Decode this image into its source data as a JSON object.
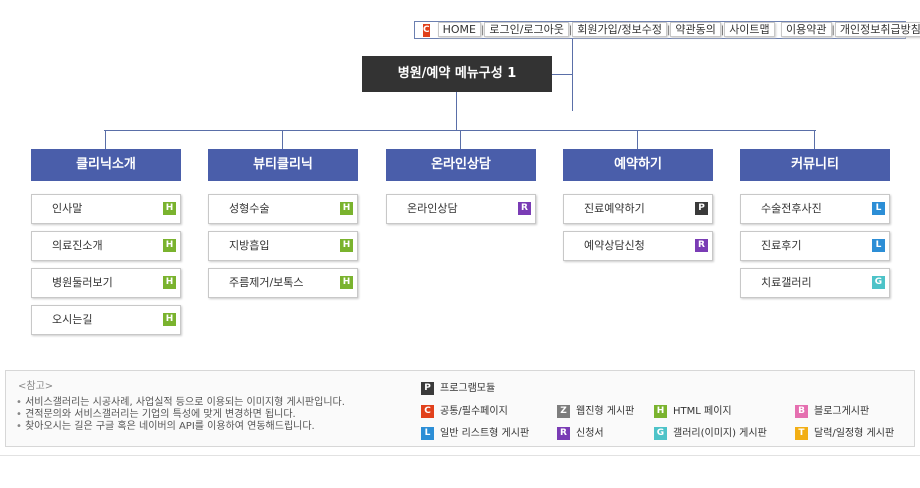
{
  "top_nav": {
    "badge": "C",
    "links": [
      "HOME",
      "로그인/로그아웃",
      "회원가입/정보수정",
      "약관동의",
      "사이트맵",
      "이용약관",
      "개인정보취급방침"
    ]
  },
  "title": "병원/예약 메뉴구성 1",
  "categories": [
    {
      "label": "클리닉소개",
      "items": [
        {
          "label": "인사말",
          "badge": "H"
        },
        {
          "label": "의료진소개",
          "badge": "H"
        },
        {
          "label": "병원둘러보기",
          "badge": "H"
        },
        {
          "label": "오시는길",
          "badge": "H"
        }
      ]
    },
    {
      "label": "뷰티클리닉",
      "items": [
        {
          "label": "성형수술",
          "badge": "H"
        },
        {
          "label": "지방흡입",
          "badge": "H"
        },
        {
          "label": "주름제거/보톡스",
          "badge": "H"
        }
      ]
    },
    {
      "label": "온라인상담",
      "items": [
        {
          "label": "온라인상담",
          "badge": "R"
        }
      ]
    },
    {
      "label": "예약하기",
      "items": [
        {
          "label": "진료예약하기",
          "badge": "P"
        },
        {
          "label": "예약상담신청",
          "badge": "R"
        }
      ]
    },
    {
      "label": "커뮤니티",
      "items": [
        {
          "label": "수술전후사진",
          "badge": "L"
        },
        {
          "label": "진료후기",
          "badge": "L"
        },
        {
          "label": "치료갤러리",
          "badge": "G"
        }
      ]
    }
  ],
  "note": {
    "heading": "<참고>",
    "lines": [
      "서비스갤러리는 시공사례, 사업실적 등으로 이용되는 이미지형 게시판입니다.",
      "견적문의와 서비스갤러리는 기업의 특성에 맞게 변경하면 됩니다.",
      "찾아오시는 길은 구글 혹은 네이버의 API를 이용하여 연동해드립니다."
    ]
  },
  "legend": [
    {
      "badge": "P",
      "label": "프로그램모듈"
    },
    {
      "badge": "C",
      "label": "공통/필수페이지"
    },
    {
      "badge": "Z",
      "label": "웹진형 게시판"
    },
    {
      "badge": "H",
      "label": "HTML 페이지"
    },
    {
      "badge": "B",
      "label": "블로그게시판"
    },
    {
      "badge": "L",
      "label": "일반 리스트형 게시판"
    },
    {
      "badge": "R",
      "label": "신청서"
    },
    {
      "badge": "G",
      "label": "갤러리(이미지) 게시판"
    },
    {
      "badge": "T",
      "label": "달력/일정형 게시판"
    }
  ],
  "badge_colors": {
    "P": "#3a3a3a",
    "C": "#e1401b",
    "Z": "#7d7d7d",
    "H": "#7ab32e",
    "B": "#e56fb0",
    "L": "#2c8ed6",
    "R": "#7a3cb5",
    "G": "#4dc3c8",
    "T": "#f2ae14"
  }
}
